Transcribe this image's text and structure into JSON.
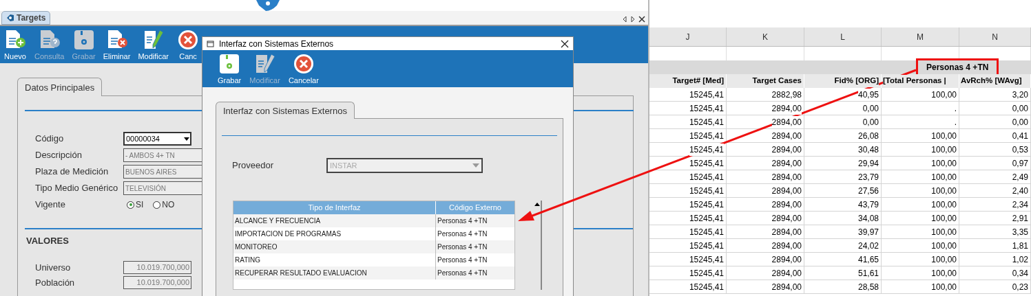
{
  "app": {
    "tab": "Targets",
    "toolbar": [
      {
        "label": "Nuevo",
        "kind": "new",
        "disabled": false
      },
      {
        "label": "Consulta",
        "kind": "query",
        "disabled": true
      },
      {
        "label": "Grabar",
        "kind": "save",
        "disabled": true
      },
      {
        "label": "Eliminar",
        "kind": "delete",
        "disabled": false
      },
      {
        "label": "Modificar",
        "kind": "edit",
        "disabled": false
      },
      {
        "label": "Canc",
        "kind": "cancel",
        "disabled": false
      }
    ],
    "form": {
      "tab": "Datos Principales",
      "fields": [
        {
          "label": "Código",
          "value": "00000034",
          "kind": "combo",
          "disabled": false
        },
        {
          "label": "Descripción",
          "value": "- AMBOS 4+ TN",
          "kind": "text",
          "disabled": true
        },
        {
          "label": "Plaza de Medición",
          "value": "BUENOS AIRES",
          "kind": "text",
          "disabled": true
        },
        {
          "label": "Tipo Medio Genérico",
          "value": "TELEVISIÓN",
          "kind": "text",
          "disabled": true
        }
      ],
      "vigente": {
        "label": "Vigente",
        "options": [
          {
            "label": "SI",
            "selected": true
          },
          {
            "label": "NO",
            "selected": false
          }
        ]
      },
      "section": "VALORES",
      "values": [
        {
          "label": "Universo",
          "value": "10.019.700,000"
        },
        {
          "label": "Población",
          "value": "10.019.700,000"
        }
      ]
    }
  },
  "dialog": {
    "title": "Interfaz con Sistemas Externos",
    "toolbar": [
      {
        "label": "Grabar",
        "kind": "save",
        "disabled": false
      },
      {
        "label": "Modificar",
        "kind": "edit",
        "disabled": true
      },
      {
        "label": "Cancelar",
        "kind": "cancel",
        "disabled": false
      }
    ],
    "tab": "Interfaz con Sistemas Externos",
    "proveedor": {
      "label": "Proveedor",
      "value": "INSTAR",
      "disabled": true
    },
    "grid": {
      "columns": [
        "Tipo de Interfaz",
        "Código Externo"
      ],
      "rows": [
        [
          "ALCANCE Y FRECUENCIA",
          "Personas 4 +TN"
        ],
        [
          "IMPORTACION DE PROGRAMAS",
          "Personas 4 +TN"
        ],
        [
          "MONITOREO",
          "Personas 4 +TN"
        ],
        [
          "RATING",
          "Personas 4 +TN"
        ],
        [
          "RECUPERAR RESULTADO EVALUACION",
          "Personas 4 +TN"
        ]
      ]
    }
  },
  "sheet": {
    "column_letters": [
      "J",
      "K",
      "L",
      "M",
      "N"
    ],
    "banner": "Personas 4 +TN",
    "headers": [
      "Target# [Med]",
      "Target Cases",
      "Fid% [ORG]",
      "[Total Personas |",
      "AvRch% [WAvg]"
    ],
    "rows": [
      [
        "15245,41",
        "2882,98",
        "40,95",
        "100,00",
        "3,20"
      ],
      [
        "15245,41",
        "2894,00",
        "0,00",
        ".",
        "0,00"
      ],
      [
        "15245,41",
        "2894,00",
        "0,00",
        ".",
        "0,00"
      ],
      [
        "15245,41",
        "2894,00",
        "26,08",
        "100,00",
        "0,41"
      ],
      [
        "15245,41",
        "2894,00",
        "30,48",
        "100,00",
        "0,53"
      ],
      [
        "15245,41",
        "2894,00",
        "29,94",
        "100,00",
        "0,97"
      ],
      [
        "15245,41",
        "2894,00",
        "23,79",
        "100,00",
        "2,49"
      ],
      [
        "15245,41",
        "2894,00",
        "27,56",
        "100,00",
        "2,40"
      ],
      [
        "15245,41",
        "2894,00",
        "43,79",
        "100,00",
        "2,34"
      ],
      [
        "15245,41",
        "2894,00",
        "34,08",
        "100,00",
        "2,91"
      ],
      [
        "15245,41",
        "2894,00",
        "39,97",
        "100,00",
        "3,35"
      ],
      [
        "15245,41",
        "2894,00",
        "24,02",
        "100,00",
        "1,81"
      ],
      [
        "15245,41",
        "2894,00",
        "41,65",
        "100,00",
        "1,02"
      ],
      [
        "15245,41",
        "2894,00",
        "51,61",
        "100,00",
        "0,34"
      ],
      [
        "15245,41",
        "2894,00",
        "28,58",
        "100,00",
        "0,23"
      ]
    ]
  }
}
